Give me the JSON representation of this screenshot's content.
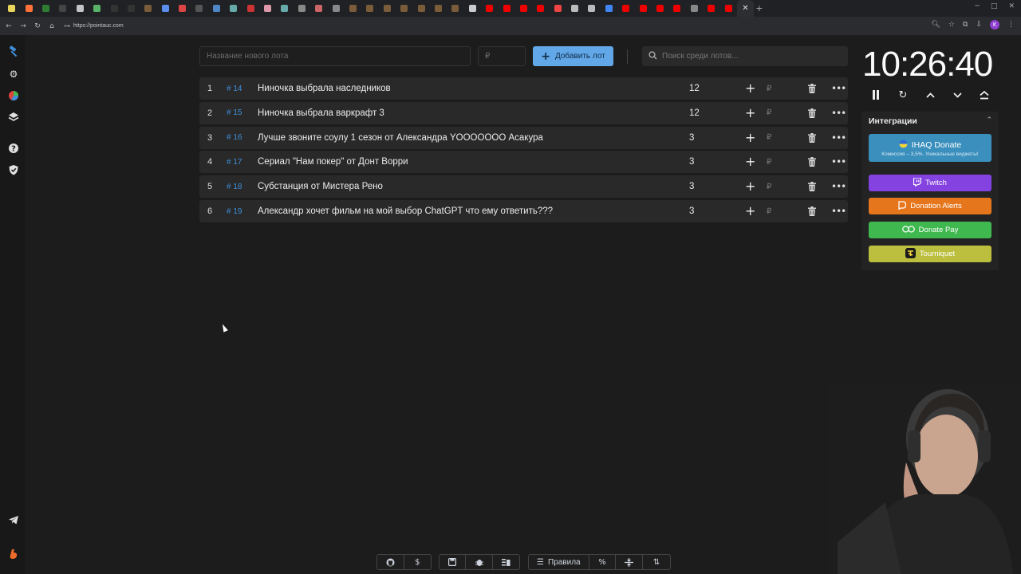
{
  "browser": {
    "url": "https://pointauc.com",
    "tab_favicons": [
      "#e8d45a",
      "#ff7139",
      "#2e7d32",
      "#444",
      "#c4c4c4",
      "#58b368",
      "#333",
      "#333",
      "#7a5c3a",
      "#5b8def",
      "#d44",
      "#555",
      "#4f86c6",
      "#6aa",
      "#c33",
      "#d9a",
      "#6aa",
      "#888",
      "#c66",
      "#888",
      "#7a5c3a",
      "#7a5c3a",
      "#7a5c3a",
      "#7a5c3a",
      "#7a5c3a",
      "#7a5c3a",
      "#7a5c3a",
      "#ccc",
      "#e00",
      "#e00",
      "#e00",
      "#e00",
      "#e44",
      "#bbb",
      "#bbb",
      "#4285f4",
      "#e00",
      "#e00",
      "#e00",
      "#e00",
      "#888",
      "#e00",
      "#e00"
    ],
    "new_tab": "+",
    "avatar_letter": "K"
  },
  "sidebar": {
    "items": [
      {
        "icon": "gavel-icon"
      },
      {
        "icon": "gear-icon"
      },
      {
        "icon": "pie-chart-icon"
      },
      {
        "icon": "layers-icon"
      },
      {
        "icon": "help-icon"
      },
      {
        "icon": "shield-check-icon"
      },
      {
        "icon": "telegram-icon"
      },
      {
        "icon": "boosty-icon"
      }
    ]
  },
  "toolbar": {
    "lot_name_placeholder": "Название нового лота",
    "amount_placeholder": "₽",
    "add_lot_label": "Добавить лот",
    "search_placeholder": "Поиск среди лотов..."
  },
  "lots": [
    {
      "index": "1",
      "id": "# 14",
      "name": "Ниночка выбрала наследников",
      "amount": "12",
      "currency": "₽"
    },
    {
      "index": "2",
      "id": "# 15",
      "name": "Ниночка выбрала варкрафт 3",
      "amount": "12",
      "currency": "₽"
    },
    {
      "index": "3",
      "id": "# 16",
      "name": "Лучше звоните соулу 1 сезон от Александра YOOOOOOO Асакура",
      "amount": "3",
      "currency": "₽"
    },
    {
      "index": "4",
      "id": "# 17",
      "name": "Сериал \"Нам покер\" от Донт Ворри",
      "amount": "3",
      "currency": "₽"
    },
    {
      "index": "5",
      "id": "# 18",
      "name": "Субстанция от Мистера Рено",
      "amount": "3",
      "currency": "₽"
    },
    {
      "index": "6",
      "id": "# 19",
      "name": "Александр хочет фильм на мой выбор ChatGPT что ему ответить???",
      "amount": "3",
      "currency": "₽"
    }
  ],
  "timer": {
    "value": "10:26:40"
  },
  "integrations": {
    "title": "Интеграции",
    "ihaq_label": "IHAQ Donate",
    "ihaq_subtitle": "Комиссия – 3,5%. Уникальные виджеты!",
    "twitch_label": "Twitch",
    "donation_alerts_label": "Donation Alerts",
    "donate_pay_label": "Donate Pay",
    "tourniquet_label": "Tourniquet",
    "colors": {
      "ihaq": "#3a8fbd",
      "twitch": "#8442e0",
      "donation_alerts": "#e6761c",
      "donate_pay": "#3fb84f",
      "tourniquet": "#bcbf3e"
    }
  },
  "bottom_toolbar": {
    "rules_label": "Правила"
  }
}
